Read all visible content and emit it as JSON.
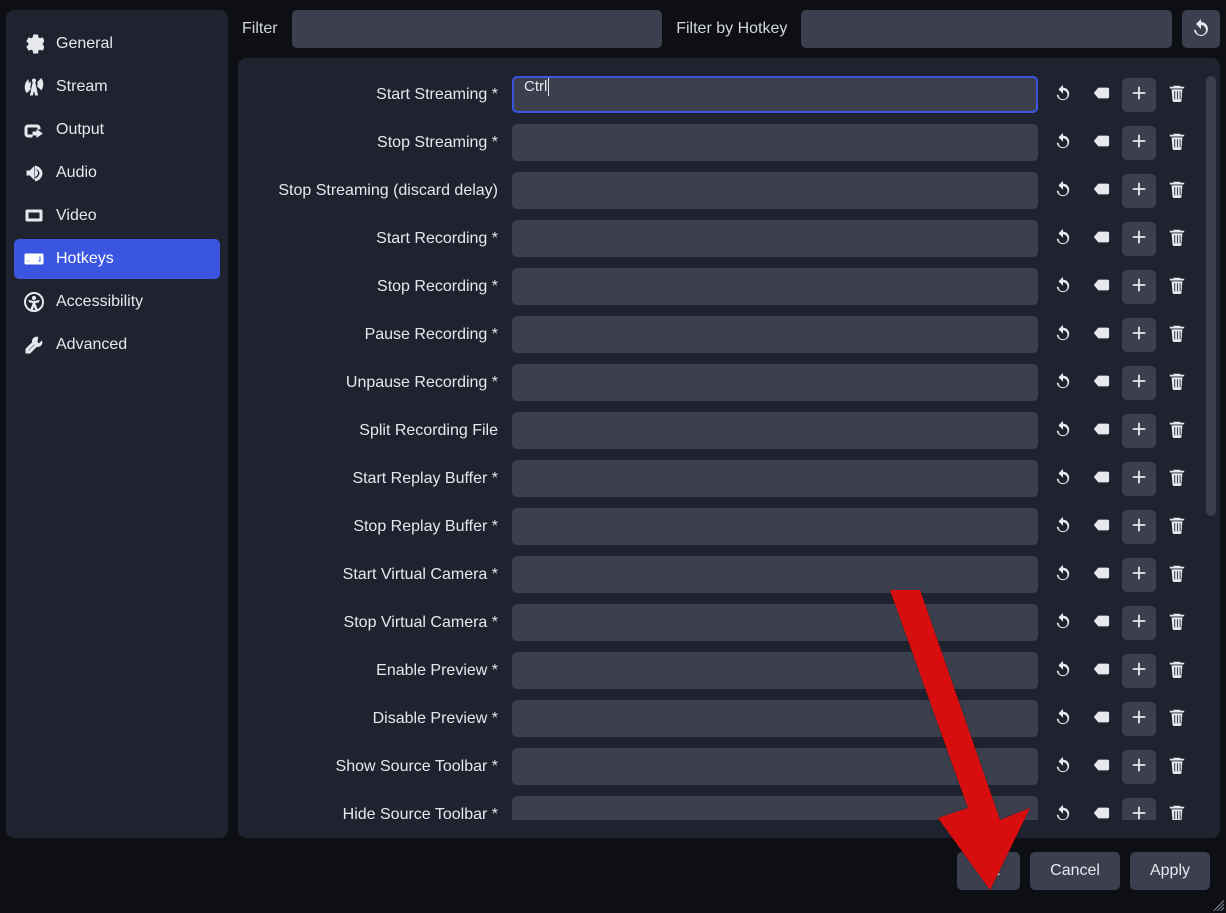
{
  "sidebar": {
    "items": [
      {
        "label": "General"
      },
      {
        "label": "Stream"
      },
      {
        "label": "Output"
      },
      {
        "label": "Audio"
      },
      {
        "label": "Video"
      },
      {
        "label": "Hotkeys"
      },
      {
        "label": "Accessibility"
      },
      {
        "label": "Advanced"
      }
    ],
    "active_index": 5
  },
  "filter": {
    "text_label": "Filter",
    "text_value": "",
    "hotkey_label": "Filter by Hotkey",
    "hotkey_value": ""
  },
  "hotkeys": [
    {
      "label": "Start Streaming *",
      "value": "Ctrl",
      "focused": true
    },
    {
      "label": "Stop Streaming *",
      "value": ""
    },
    {
      "label": "Stop Streaming (discard delay)",
      "value": ""
    },
    {
      "label": "Start Recording *",
      "value": ""
    },
    {
      "label": "Stop Recording *",
      "value": ""
    },
    {
      "label": "Pause Recording *",
      "value": ""
    },
    {
      "label": "Unpause Recording *",
      "value": ""
    },
    {
      "label": "Split Recording File",
      "value": ""
    },
    {
      "label": "Start Replay Buffer *",
      "value": ""
    },
    {
      "label": "Stop Replay Buffer *",
      "value": ""
    },
    {
      "label": "Start Virtual Camera *",
      "value": ""
    },
    {
      "label": "Stop Virtual Camera *",
      "value": ""
    },
    {
      "label": "Enable Preview *",
      "value": ""
    },
    {
      "label": "Disable Preview *",
      "value": ""
    },
    {
      "label": "Show Source Toolbar *",
      "value": ""
    },
    {
      "label": "Hide Source Toolbar *",
      "value": ""
    }
  ],
  "footer": {
    "ok": "OK",
    "cancel": "Cancel",
    "apply": "Apply"
  },
  "icons": {
    "general": "gear-icon",
    "stream": "antenna-icon",
    "output": "output-icon",
    "audio": "speaker-icon",
    "video": "monitor-icon",
    "hotkeys": "keyboard-icon",
    "accessibility": "accessibility-icon",
    "advanced": "tools-icon",
    "reset": "undo-icon",
    "clear": "backspace-icon",
    "add": "plus-icon",
    "delete": "trash-icon"
  },
  "colors": {
    "accent": "#3a55e0",
    "panel": "#1f2330",
    "control": "#3c404e",
    "bg": "#0d0f14",
    "arrow": "#d8100a"
  }
}
